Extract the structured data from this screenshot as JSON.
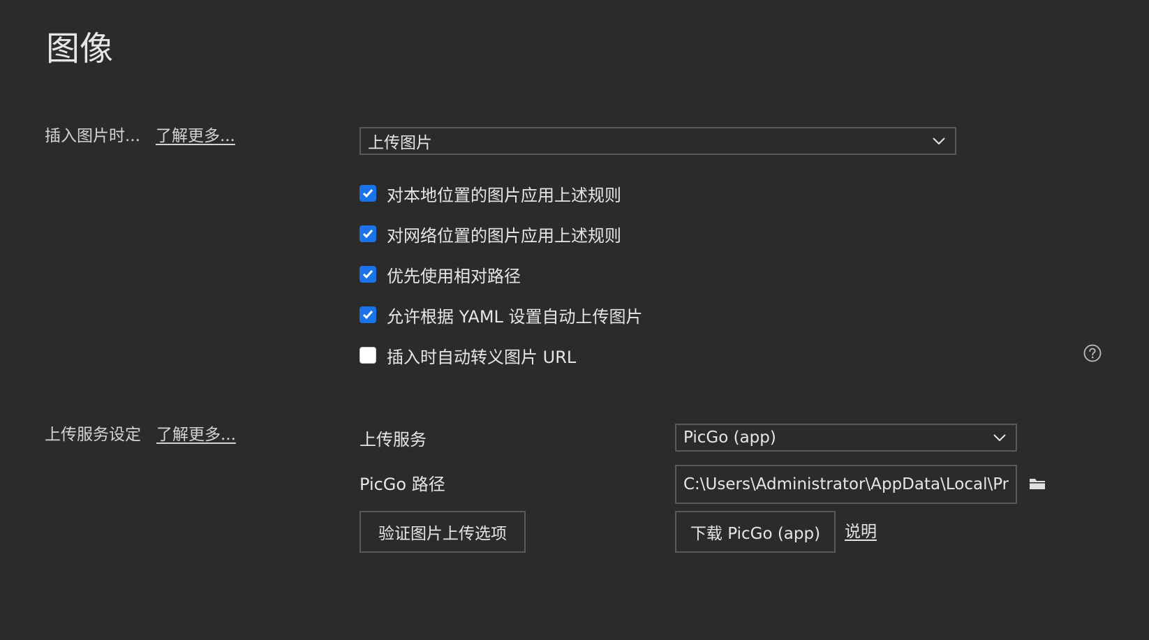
{
  "page": {
    "title": "图像"
  },
  "insert_image": {
    "label": "插入图片时...",
    "learn_more": "了解更多...",
    "dropdown_value": "上传图片",
    "checkboxes": [
      {
        "label": "对本地位置的图片应用上述规则",
        "checked": true
      },
      {
        "label": "对网络位置的图片应用上述规则",
        "checked": true
      },
      {
        "label": "优先使用相对路径",
        "checked": true
      },
      {
        "label": "允许根据 YAML 设置自动上传图片",
        "checked": true
      },
      {
        "label": "插入时自动转义图片 URL",
        "checked": false
      }
    ]
  },
  "upload_service": {
    "label": "上传服务设定",
    "learn_more": "了解更多...",
    "service_label": "上传服务",
    "service_value": "PicGo (app)",
    "path_label": "PicGo 路径",
    "path_value": "C:\\Users\\Administrator\\AppData\\Local\\Programs\\PicGo\\PicGo.exe",
    "verify_button": "验证图片上传选项",
    "download_button": "下载 PicGo (app)",
    "help_link": "说明"
  },
  "colors": {
    "background": "#2b2b2b",
    "checkbox_accent": "#1a73e8"
  },
  "icons": [
    "chevron-down-icon",
    "question-circle-icon",
    "folder-icon",
    "checkmark-icon"
  ]
}
